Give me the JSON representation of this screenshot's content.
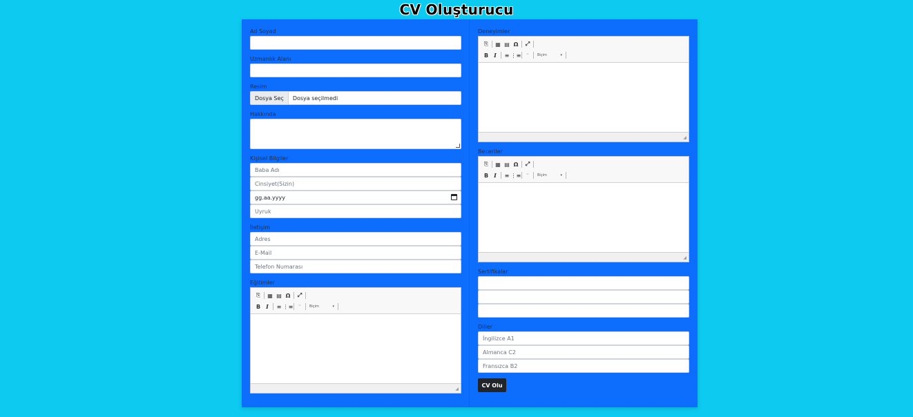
{
  "page": {
    "title": "CV Oluşturucu"
  },
  "left": {
    "ad_soyad_label": "Ad Soyad",
    "uzmanlik_label": "Uzmanlık Alanı",
    "resim_label": "Resim",
    "file_button": "Dosya Seç",
    "file_status": "Dosya seçilmedi",
    "hakkinda_label": "Hakkında",
    "kisisel_label": "Kişisel Bilgiler",
    "baba_adi_placeholder": "Baba Adı",
    "cinsiyet_placeholder": "Cinsiyet(Sizin)",
    "tarih_value": "gg.aa.yyyy",
    "uyruk_placeholder": "Uyruk",
    "iletisim_label": "İletişim",
    "adres_placeholder": "Adres",
    "email_placeholder": "E-Mail",
    "telefon_placeholder": "Telefon Numarası",
    "egitimler_label": "Eğitimler"
  },
  "right": {
    "deneyimler_label": "Deneyimler",
    "beceriler_label": "Beceriler",
    "sertifikalar_label": "Sertifikalar",
    "diller_label": "Diller",
    "dil1_placeholder": "İngilizce A1",
    "dil2_placeholder": "Almanca C2",
    "dil3_placeholder": "Fransızca B2",
    "submit_label": "CV Olu"
  },
  "editor": {
    "icons": [
      "paste-icon",
      "table-icon",
      "horizontal-rule-icon",
      "special-char-icon",
      "maximize-icon",
      "bold-icon",
      "italic-icon",
      "numbered-list-icon",
      "bulleted-list-icon",
      "blockquote-icon",
      "styles-dropdown"
    ],
    "styles_label": "Biçim"
  },
  "colors": {
    "background": "#0dcaf0",
    "panel": "#0d6efd",
    "button": "#212529"
  }
}
